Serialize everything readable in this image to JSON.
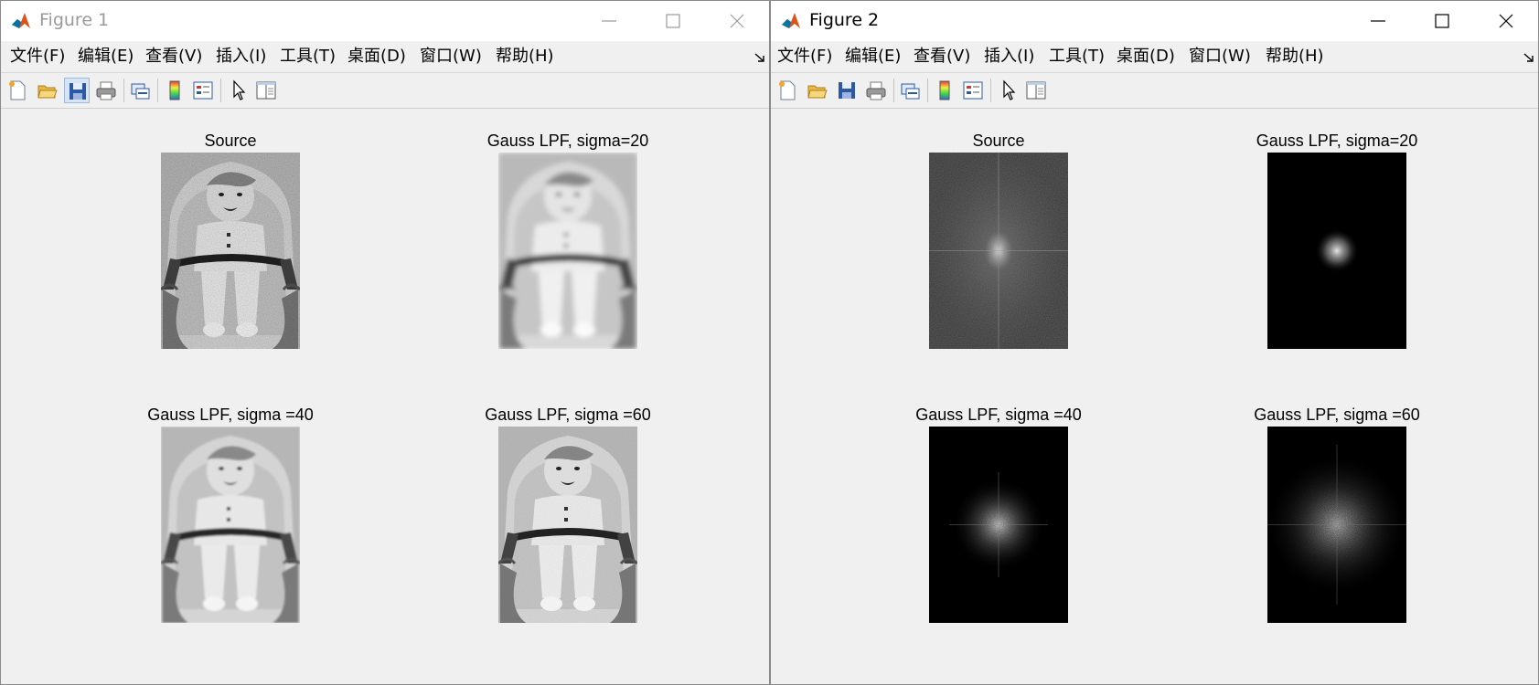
{
  "windows": [
    {
      "title": "Figure 1",
      "active": false,
      "menu": [
        "文件(F)",
        "编辑(E)",
        "查看(V)",
        "插入(I)",
        "工具(T)",
        "桌面(D)",
        "窗口(W)",
        "帮助(H)"
      ],
      "toolbar": [
        "new-figure-icon",
        "open-file-icon",
        "save-icon",
        "print-icon",
        "link-plot-icon",
        "colorbar-icon",
        "legend-icon",
        "edit-plot-icon",
        "property-inspector-icon"
      ],
      "axes": [
        {
          "title": "Source",
          "content": "baby-photo-noisy"
        },
        {
          "title": "Gauss LPF, sigma=20",
          "content": "baby-photo-blurred"
        },
        {
          "title": "Gauss LPF, sigma =40",
          "content": "baby-photo-filtered"
        },
        {
          "title": "Gauss LPF, sigma =60",
          "content": "baby-photo-filtered-sharp"
        }
      ]
    },
    {
      "title": "Figure 2",
      "active": true,
      "menu": [
        "文件(F)",
        "编辑(E)",
        "查看(V)",
        "插入(I)",
        "工具(T)",
        "桌面(D)",
        "窗口(W)",
        "帮助(H)"
      ],
      "toolbar": [
        "new-figure-icon",
        "open-file-icon",
        "save-icon",
        "print-icon",
        "link-plot-icon",
        "colorbar-icon",
        "legend-icon",
        "edit-plot-icon",
        "property-inspector-icon"
      ],
      "axes": [
        {
          "title": "Source",
          "content": "fft-spectrum-full"
        },
        {
          "title": "Gauss LPF, sigma=20",
          "content": "fft-spectrum-sigma20"
        },
        {
          "title": "Gauss LPF, sigma =40",
          "content": "fft-spectrum-sigma40"
        },
        {
          "title": "Gauss LPF, sigma =60",
          "content": "fft-spectrum-sigma60"
        }
      ]
    }
  ]
}
